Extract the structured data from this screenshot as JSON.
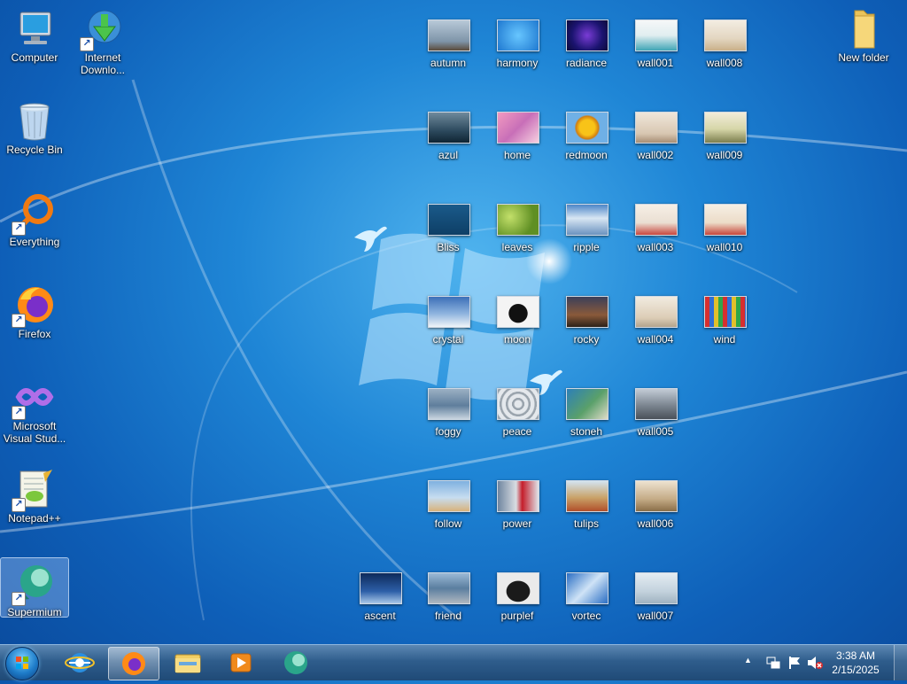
{
  "left_icons": [
    {
      "label": "Computer",
      "icon": "computer-icon"
    },
    {
      "label": "Internet Downlo...",
      "icon": "internet-download-manager-icon"
    },
    {
      "label": "Recycle Bin",
      "icon": "recycle-bin-icon"
    },
    {
      "label": "Everything",
      "icon": "everything-icon"
    },
    {
      "label": "Firefox",
      "icon": "firefox-icon"
    },
    {
      "label": "Microsoft Visual Stud...",
      "icon": "visual-studio-icon"
    },
    {
      "label": "Notepad++",
      "icon": "notepadpp-icon"
    },
    {
      "label": "Supermium",
      "icon": "supermium-icon"
    }
  ],
  "wallpapers": {
    "col1": [
      "ascent"
    ],
    "col2": [
      "autumn",
      "azul",
      "Bliss",
      "crystal",
      "foggy",
      "follow",
      "friend"
    ],
    "col3": [
      "harmony",
      "home",
      "leaves",
      "moon",
      "peace",
      "power",
      "purplef"
    ],
    "col4": [
      "radiance",
      "redmoon",
      "ripple",
      "rocky",
      "stoneh",
      "tulips",
      "vortec"
    ],
    "col5": [
      "wall001",
      "wall002",
      "wall003",
      "wall004",
      "wall005",
      "wall006",
      "wall007"
    ],
    "col6": [
      "wall008",
      "wall009",
      "wall010",
      "wind"
    ]
  },
  "folder": {
    "label": "New folder"
  },
  "tray": {
    "time": "3:38 AM",
    "date": "2/15/2025",
    "show_hidden": "▲"
  },
  "colors": {
    "accent": "#1f86d6",
    "taskbar": "#2f5d8c"
  }
}
